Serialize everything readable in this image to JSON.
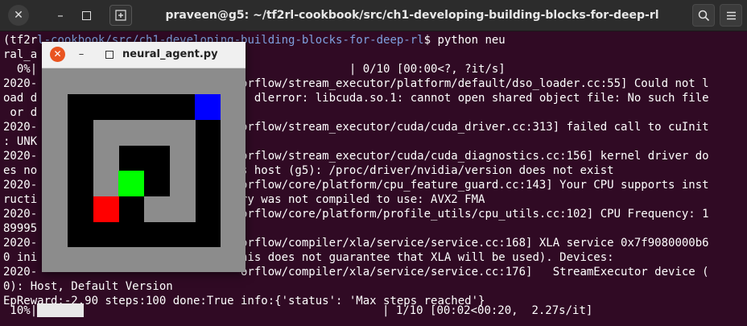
{
  "titlebar": {
    "title": "praveen@g5: ~/tf2rl-cookbook/src/ch1-developing-building-blocks-for-deep-rl",
    "close_glyph": "✕",
    "minimize_glyph": "–",
    "icons": [
      "close-icon",
      "minimize-icon",
      "maximize-icon",
      "new-tab-icon",
      "search-icon",
      "hamburger-menu-icon"
    ]
  },
  "terminal": {
    "prompt_prefix": "(tf2r",
    "prompt_path": "l-cookbook/src/ch1-developing-building-blocks-for-deep-rl",
    "prompt_suffix": "$ python neu",
    "lines": [
      "ral_a",
      "  0%|                                              | 0/10 [00:00<?, ?it/s]",
      "2020-                              orflow/stream_executor/platform/default/dso_loader.cc:55] Could not l",
      "oad d                              ; dlerror: libcuda.so.1: cannot open shared object file: No such file",
      " or d",
      "2020-                              orflow/stream_executor/cuda/cuda_driver.cc:313] failed call to cuInit",
      ": UNK",
      "2020-                              orflow/stream_executor/cuda/cuda_diagnostics.cc:156] kernel driver do",
      "es no                              s host (g5): /proc/driver/nvidia/version does not exist",
      "2020-                              orflow/core/platform/cpu_feature_guard.cc:143] Your CPU supports inst",
      "ructi                              ry was not compiled to use: AVX2 FMA",
      "2020-                              orflow/core/platform/profile_utils/cpu_utils.cc:102] CPU Frequency: 1",
      "89995",
      "2020-                              orflow/compiler/xla/service/service.cc:168] XLA service 0x7f9080000b6",
      "0 ini                              his does not guarantee that XLA will be used). Devices:",
      "2020-                              orflow/compiler/xla/service/service.cc:176]   StreamExecutor device (",
      "0): Host, Default Version",
      "EpReward:-2.90 steps:100 done:True info:{'status': 'Max steps reached'}"
    ],
    "progress_prefix": " 10%|",
    "progress_fraction": 0.1,
    "progress_suffix": "                                            | 1/10 [00:02<00:20,  2.27s/it]"
  },
  "window": {
    "title": "neural_agent.py",
    "close_glyph": "✕",
    "minimize_glyph": "–",
    "icons": [
      "close-icon",
      "minimize-icon",
      "maximize-icon"
    ],
    "colors": {
      "background": "#8c8c8c",
      "board": "#000000",
      "wall": "#8c8c8c",
      "goal": "#0000ff",
      "agent": "#00ff00",
      "trap": "#ff0000"
    },
    "grid_size": 6,
    "walls": [
      [
        1,
        1
      ],
      [
        1,
        2
      ],
      [
        1,
        3
      ],
      [
        1,
        4
      ],
      [
        2,
        1
      ],
      [
        2,
        4
      ],
      [
        3,
        1
      ],
      [
        3,
        4
      ],
      [
        4,
        3
      ],
      [
        4,
        4
      ]
    ],
    "goal": [
      0,
      5
    ],
    "agent": [
      3,
      2
    ],
    "trap": [
      4,
      1
    ]
  }
}
